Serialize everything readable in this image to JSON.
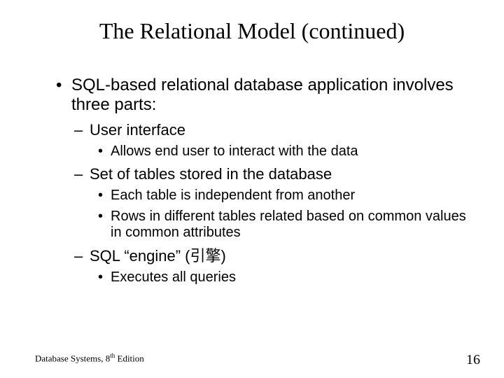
{
  "title": "The Relational Model (continued)",
  "bullets": {
    "b1": "SQL-based relational database application involves three parts:",
    "b1a": "User interface",
    "b1a1": "Allows end user to interact with the data",
    "b1b": "Set of tables stored in the database",
    "b1b1": "Each table is independent from another",
    "b1b2": "Rows in different tables related based on common values in common attributes",
    "b1c": "SQL “engine” (引擎)",
    "b1c1": "Executes all queries"
  },
  "footer": {
    "book": "Database Systems, 8",
    "sup": "th",
    "ed": " Edition",
    "page": "16"
  }
}
